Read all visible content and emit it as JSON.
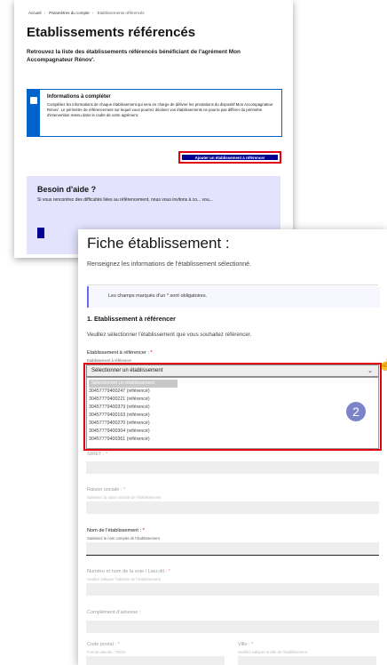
{
  "back_page": {
    "breadcrumb": [
      "Accueil",
      "Paramètres du compte",
      "Etablissements référencés"
    ],
    "title": "Etablissements référencés",
    "subtitle": "Retrouvez la liste des établissements référencés bénéficiant de l'agrément Mon Accompagnateur Rénov'.",
    "info_box": {
      "title": "Informations à compléter",
      "text": "Complétez les informations de chaque établissement qui sera en charge de délivrer les prestations du dispositif Mon Accompagnateur Rénov'. Le périmètre de référencement sur lequel vous pourrez déclarer vos établissements ne pourra pas différer du périmètre d'intervention retenu dans le cadre de votre agrément."
    },
    "add_button_label": "Ajouter un établissement à référencer",
    "help": {
      "title": "Besoin d'aide ?",
      "text": "Si vous rencontrez des difficultés liées au référencement, nous vous invitons à co... vou..."
    }
  },
  "front_page": {
    "title": "Fiche établissement :",
    "subtitle": "Renseignez les informations de l'établissement sélectionné.",
    "notice": "Les champs marqués d'un * sont obligatoires.",
    "section_title": "1. Etablissement à référencer",
    "section_sub": "Veuillez sélectionner l'établissement que vous souhaitez référencer.",
    "select_label": "Etablissement à référencer :",
    "required_mark": "*",
    "select_hint": "Etablissement à référencer",
    "select_value": "Sélectionner un établissement",
    "dropdown_options": [
      "Sélectionner un établissement",
      "30457779400247 (référencé)",
      "30457779400221 (référencé)",
      "30457779400379 (référencé)",
      "30457779400163 (référencé)",
      "30457779400270 (référencé)",
      "30457779400304 (référencé)",
      "30457779400361 (référencé)"
    ],
    "badge": "2",
    "fields": {
      "siret_label": "SIRET :",
      "raison_label": "Raison sociale :",
      "raison_hint": "Saisissez la raison sociale de l'établissement",
      "nom_label": "Nom de l'établissement :",
      "nom_hint": "Saisissez le nom complet de l'établissement",
      "voie_label": "Numéro et nom de la voie / Lieu-dit :",
      "voie_hint": "Veuillez indiquer l'adresse de l'établissement",
      "complement_label": "Complément d'adresse :",
      "cp_label": "Code postal :",
      "cp_hint": "Format attendu : 75010",
      "ville_label": "Ville :",
      "ville_hint": "Veuillez indiquer la ville de l'établissement"
    }
  },
  "colors": {
    "primary": "#000091",
    "highlight": "#e1000f",
    "info": "#0063cb",
    "badge": "#7b83c9",
    "help_bg": "#e3e3fd"
  }
}
